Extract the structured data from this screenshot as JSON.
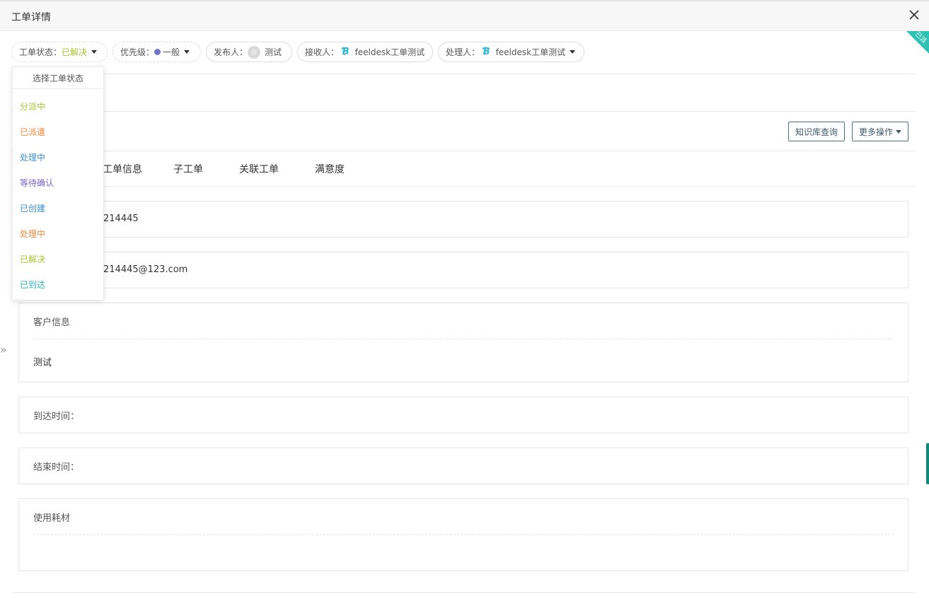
{
  "window": {
    "title": "工单详情",
    "ribbon": "已派"
  },
  "filters": {
    "status_label": "工单状态：",
    "status_value": "已解决",
    "priority_label": "优先级：",
    "priority_value": "一般",
    "publisher_label": "发布人：",
    "publisher_value": "测试",
    "receiver_label": "接收人：",
    "receiver_value": "feeldesk工单测试",
    "handler_label": "处理人：",
    "handler_value": "feeldesk工单测试"
  },
  "dropdown": {
    "header": "选择工单状态",
    "options": [
      {
        "label": "分派中",
        "color": "#a6c531"
      },
      {
        "label": "已派遣",
        "color": "#f08a3c"
      },
      {
        "label": "处理中",
        "color": "#3d8fd6"
      },
      {
        "label": "等待确认",
        "color": "#7b62c8"
      },
      {
        "label": "已创建",
        "color": "#3d8fd6"
      },
      {
        "label": "处理中",
        "color": "#f08a3c"
      },
      {
        "label": "已解决",
        "color": "#a6c531"
      },
      {
        "label": "已到达",
        "color": "#2fb3b8"
      }
    ]
  },
  "actions": {
    "kb_search": "知识库查询",
    "more": "更多操作"
  },
  "tabs": [
    "工单信息",
    "子工单",
    "关联工单",
    "满意度"
  ],
  "fields": {
    "phone_value": "214445",
    "email_value": "214445@123.com",
    "customer_label": "客户信息",
    "customer_value": "测试",
    "arrival_label": "到达时间：",
    "end_label": "结束时间：",
    "materials_label": "使用耗材"
  },
  "colors": {
    "accent": "#2fc1b3",
    "border_dark": "#4d6f83"
  }
}
